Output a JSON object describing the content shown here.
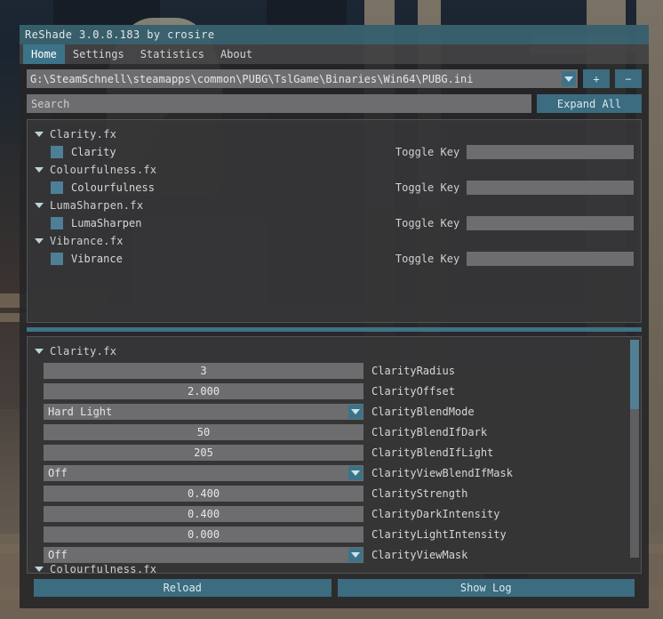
{
  "window": {
    "title": "ReShade 3.0.8.183 by crosire",
    "tabs": [
      {
        "label": "Home",
        "active": true
      },
      {
        "label": "Settings",
        "active": false
      },
      {
        "label": "Statistics",
        "active": false
      },
      {
        "label": "About",
        "active": false
      }
    ]
  },
  "preset": {
    "path": "G:\\SteamSchnell\\steamapps\\common\\PUBG\\TslGame\\Binaries\\Win64\\PUBG.ini",
    "add_label": "+",
    "remove_label": "−"
  },
  "search": {
    "placeholder": "Search",
    "value": "Search",
    "expand_all_label": "Expand All"
  },
  "effects": {
    "toggle_key_label": "Toggle Key",
    "items": [
      {
        "file": "Clarity.fx",
        "technique": "Clarity",
        "enabled": true,
        "toggle_key": ""
      },
      {
        "file": "Colourfulness.fx",
        "technique": "Colourfulness",
        "enabled": true,
        "toggle_key": ""
      },
      {
        "file": "LumaSharpen.fx",
        "technique": "LumaSharpen",
        "enabled": true,
        "toggle_key": ""
      },
      {
        "file": "Vibrance.fx",
        "technique": "Vibrance",
        "enabled": true,
        "toggle_key": ""
      }
    ]
  },
  "variables": {
    "group": "Clarity.fx",
    "rows": [
      {
        "value": "3",
        "label": "ClarityRadius",
        "type": "slider"
      },
      {
        "value": "2.000",
        "label": "ClarityOffset",
        "type": "slider"
      },
      {
        "value": "Hard Light",
        "label": "ClarityBlendMode",
        "type": "combo"
      },
      {
        "value": "50",
        "label": "ClarityBlendIfDark",
        "type": "slider"
      },
      {
        "value": "205",
        "label": "ClarityBlendIfLight",
        "type": "slider"
      },
      {
        "value": "Off",
        "label": "ClarityViewBlendIfMask",
        "type": "combo"
      },
      {
        "value": "0.400",
        "label": "ClarityStrength",
        "type": "slider"
      },
      {
        "value": "0.400",
        "label": "ClarityDarkIntensity",
        "type": "slider"
      },
      {
        "value": "0.000",
        "label": "ClarityLightIntensity",
        "type": "slider"
      },
      {
        "value": "Off",
        "label": "ClarityViewMask",
        "type": "combo"
      }
    ],
    "next_group_partial": "Colourfulness.fx"
  },
  "footer": {
    "reload_label": "Reload",
    "show_log_label": "Show Log"
  },
  "colors": {
    "accent": "#3d7388",
    "checkbox": "#4d7f96",
    "field": "#6d6d6f",
    "panel": "#38383a"
  }
}
